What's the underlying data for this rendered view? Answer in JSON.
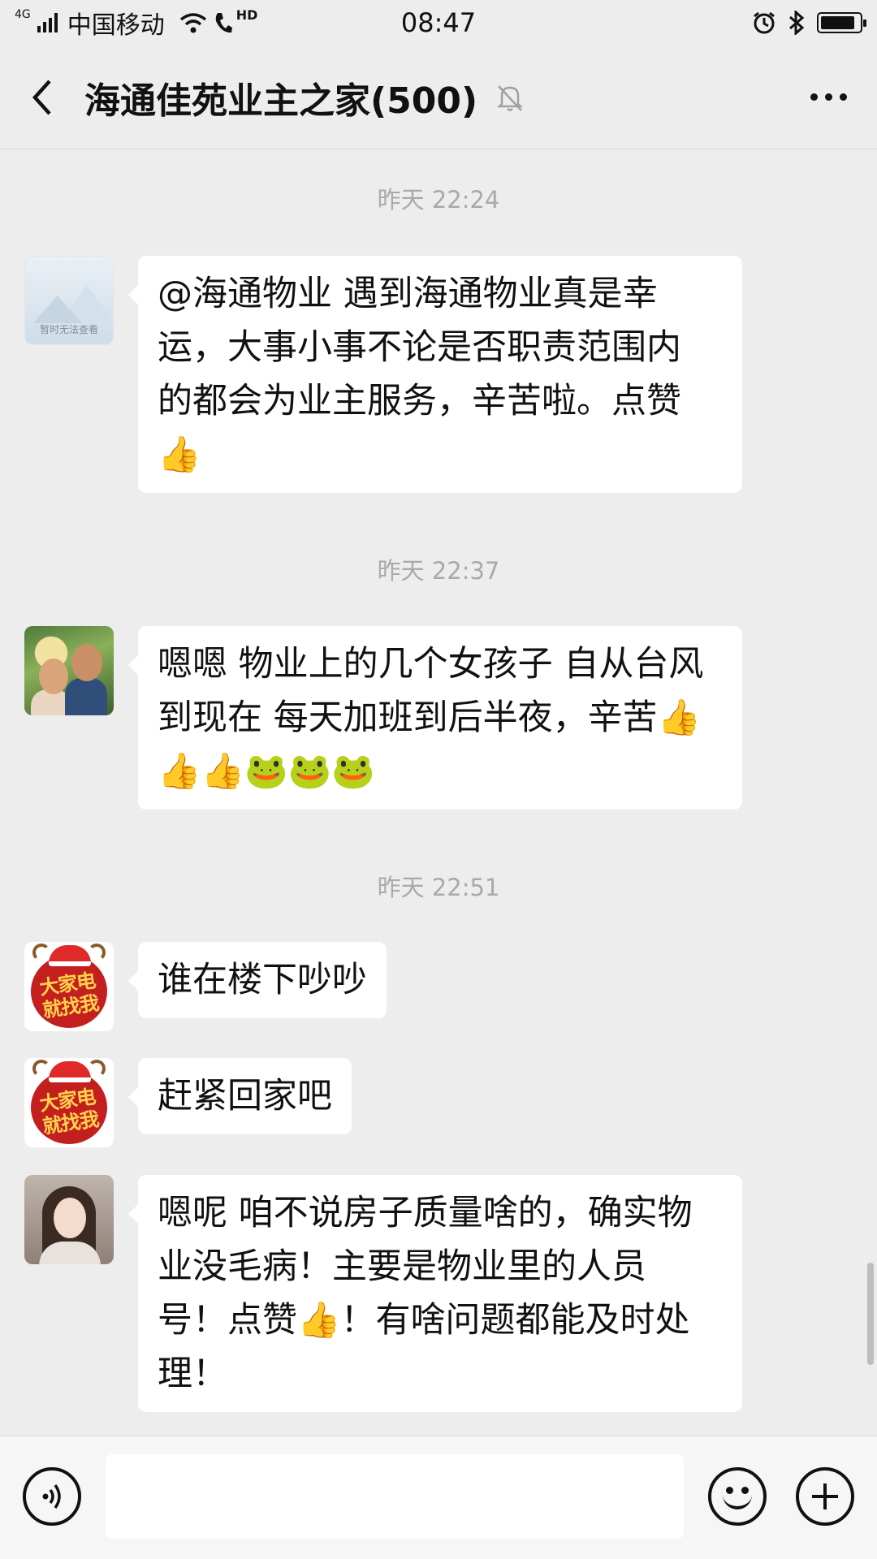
{
  "status_bar": {
    "network_type": "4G",
    "carrier": "中国移动",
    "hd_label": "HD",
    "time": "08:47",
    "battery_level": 0.9
  },
  "header": {
    "title": "海通佳苑业主之家(500)",
    "back_icon": "chevron-left-icon",
    "mute_icon": "bell-muted-icon",
    "more_icon": "more-horizontal-icon"
  },
  "messages": [
    {
      "timestamp": "昨天 22:24",
      "avatar_caption": "暂时无法查看",
      "lines": [
        "@海通物业  遇到海通物业真是幸",
        "运，大事小事不论是否职责范围内",
        "的都会为业主服务，辛苦啦。点赞"
      ],
      "emoji_line": "👍"
    },
    {
      "timestamp": "昨天 22:37",
      "lines": [
        "嗯嗯 物业上的几个女孩子 自从台风",
        "到现在 每天加班到后半夜，辛苦👍"
      ],
      "emoji_line": "👍👍🐸🐸🐸"
    },
    {
      "timestamp": "昨天 22:51",
      "avatar_text": "大家电 就找我",
      "text": "谁在楼下吵吵"
    },
    {
      "avatar_text": "大家电 就找我",
      "text": "赶紧回家吧"
    },
    {
      "lines": [
        "嗯呢 咱不说房子质量啥的，确实物",
        "业没毛病！主要是物业里的人员",
        "号！点赞👍！有啥问题都能及时处",
        "理！"
      ]
    }
  ],
  "input_bar": {
    "voice_icon": "voice-icon",
    "input_value": "",
    "emoji_icon": "smiley-icon",
    "plus_icon": "plus-circle-icon"
  }
}
